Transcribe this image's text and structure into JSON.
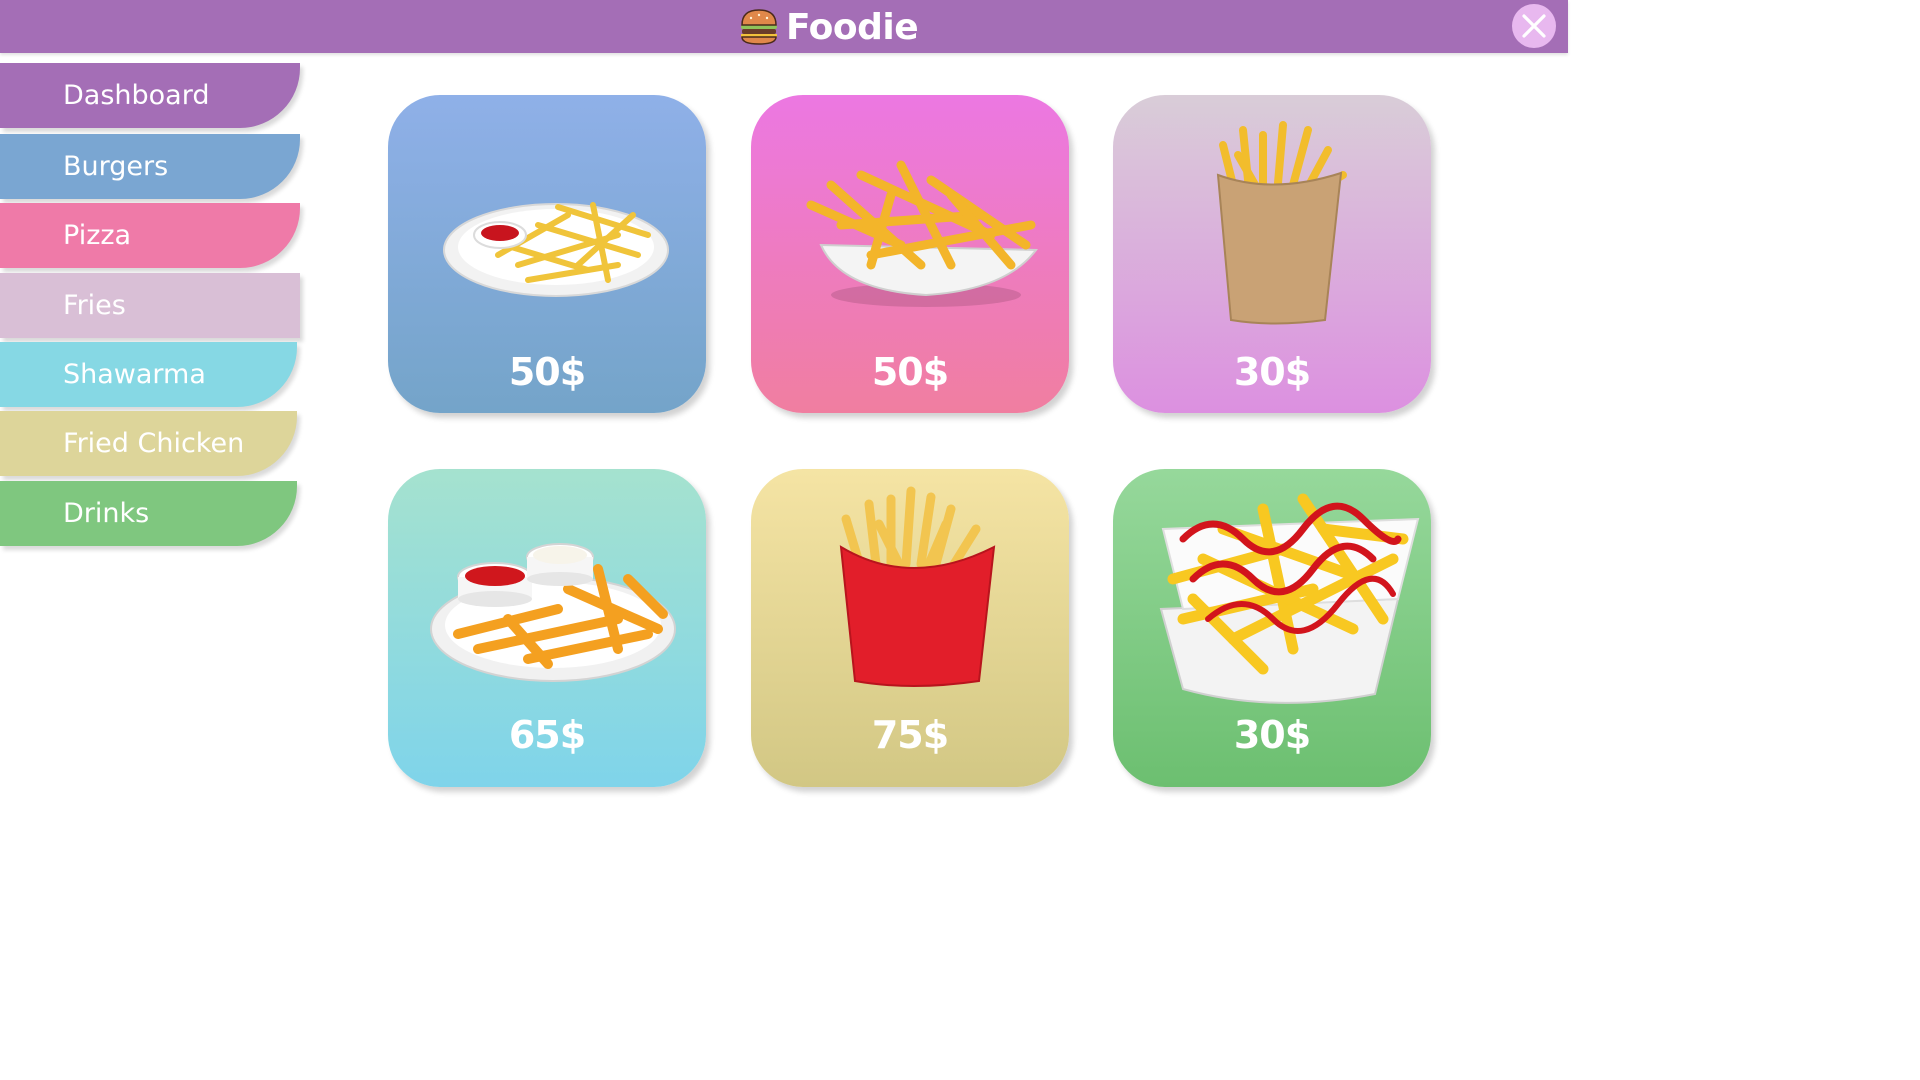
{
  "app": {
    "title": "Foodie",
    "close_icon": "close-icon",
    "logo_icon": "burger-icon",
    "header_color": "#a46eb6"
  },
  "sidebar": {
    "items": [
      {
        "label": "Dashboard",
        "color": "#a46eb6"
      },
      {
        "label": "Burgers",
        "color": "#7aa6d2"
      },
      {
        "label": "Pizza",
        "color": "#ef7aa8"
      },
      {
        "label": "Fries",
        "color": "#d9bfd6"
      },
      {
        "label": "Shawarma",
        "color": "#86d8e4"
      },
      {
        "label": "Fried Chicken",
        "color": "#ddd59a"
      },
      {
        "label": "Drinks",
        "color": "#7fc77f"
      }
    ]
  },
  "products": [
    {
      "price": "50$",
      "image": "fries-plate-ketchup"
    },
    {
      "price": "50$",
      "image": "fries-paper-tray"
    },
    {
      "price": "30$",
      "image": "fries-paper-cup"
    },
    {
      "price": "65$",
      "image": "fries-plate-dips"
    },
    {
      "price": "75$",
      "image": "fries-red-box"
    },
    {
      "price": "30$",
      "image": "fries-box-ketchup"
    }
  ]
}
